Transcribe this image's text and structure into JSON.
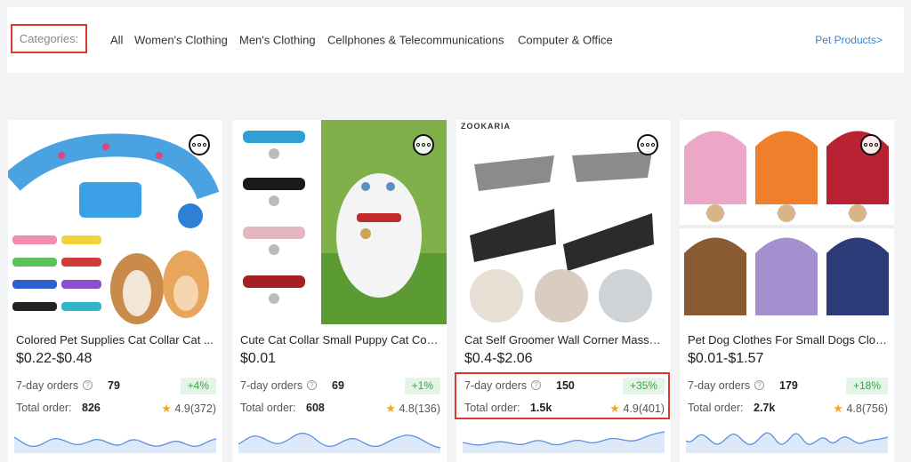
{
  "categories": {
    "label": "Categories:",
    "items": [
      "All",
      "Women's Clothing",
      "Men's Clothing",
      "Cellphones & Telecommunications",
      "Computer & Office"
    ],
    "pet_link": "Pet Products>"
  },
  "accent_color": "#3b82c8",
  "highlight_color": "#d93a30",
  "growth_color": "#37a64a",
  "products": [
    {
      "title": "Colored Pet Supplies Cat Collar Cat ...",
      "price": "$0.22-$0.48",
      "orders_7day_label": "7-day orders",
      "orders_7day": "79",
      "growth": "+4%",
      "total_label": "Total order:",
      "total": "826",
      "rating": "4.9(372)",
      "more_icon": "more-icon",
      "help_icon": "question-icon"
    },
    {
      "title": "Cute Cat Collar Small Puppy Cat Coll...",
      "price": "$0.01",
      "orders_7day_label": "7-day orders",
      "orders_7day": "69",
      "growth": "+1%",
      "total_label": "Total order:",
      "total": "608",
      "rating": "4.8(136)",
      "more_icon": "more-icon",
      "help_icon": "question-icon"
    },
    {
      "title": "Cat Self Groomer Wall Corner Massa...",
      "price": "$0.4-$2.06",
      "orders_7day_label": "7-day orders",
      "orders_7day": "150",
      "growth": "+35%",
      "total_label": "Total order:",
      "total": "1.5k",
      "rating": "4.9(401)",
      "brand_text": "ZOOKARIA",
      "more_icon": "more-icon",
      "help_icon": "question-icon"
    },
    {
      "title": "Pet Dog Clothes For Small Dogs Clot...",
      "price": "$0.01-$1.57",
      "orders_7day_label": "7-day orders",
      "orders_7day": "179",
      "growth": "+18%",
      "total_label": "Total order:",
      "total": "2.7k",
      "rating": "4.8(756)",
      "more_icon": "more-icon",
      "help_icon": "question-icon"
    }
  ]
}
